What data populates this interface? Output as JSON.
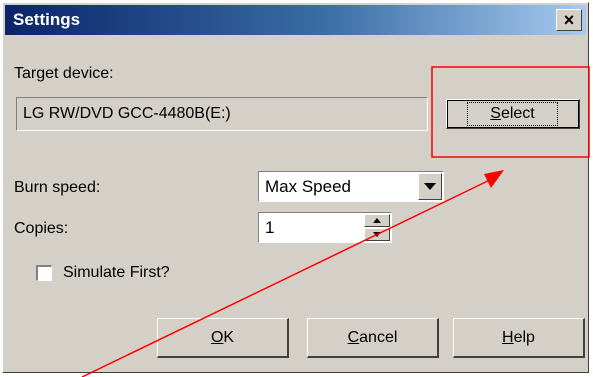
{
  "dialog": {
    "title": "Settings",
    "close_glyph": "×"
  },
  "target": {
    "label": "Target device:",
    "value": "LG RW/DVD GCC-4480B(E:)",
    "select_button": {
      "mnemonic": "S",
      "rest": "elect"
    }
  },
  "burn_speed": {
    "label": "Burn speed:",
    "selected": "Max Speed"
  },
  "copies": {
    "label": "Copies:",
    "value": "1"
  },
  "simulate": {
    "label": "Simulate First?",
    "checked": false
  },
  "buttons": {
    "ok": {
      "mnemonic": "O",
      "rest": "K"
    },
    "cancel": {
      "mnemonic": "C",
      "rest": "ancel"
    },
    "help": {
      "mnemonic": "H",
      "rest": "elp"
    }
  },
  "annotation": {
    "color": "#ff0000"
  }
}
